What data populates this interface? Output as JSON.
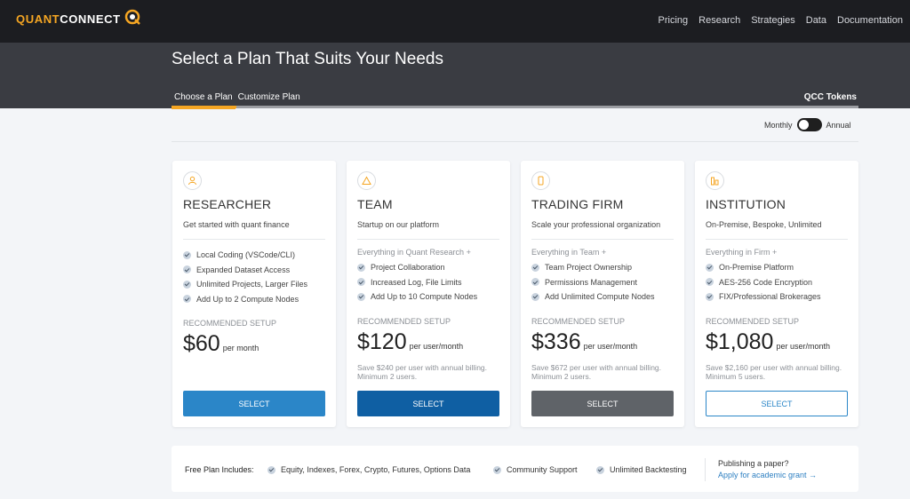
{
  "nav": {
    "logo_q": "QUANT",
    "logo_rest": "CONNECT",
    "links": [
      "Pricing",
      "Research",
      "Strategies",
      "Data",
      "Documentation"
    ]
  },
  "header": {
    "title": "Select a Plan That Suits Your Needs",
    "tabs": [
      "Choose a Plan",
      "Customize Plan"
    ],
    "right_tab": "QCC Tokens"
  },
  "billing": {
    "left": "Monthly",
    "right": "Annual"
  },
  "plans": [
    {
      "name": "RESEARCHER",
      "desc": "Get started with quant finance",
      "lead": "",
      "features": [
        "Local Coding (VSCode/CLI)",
        "Expanded Dataset Access",
        "Unlimited Projects, Larger Files",
        "Add Up to 2 Compute Nodes"
      ],
      "rec": "RECOMMENDED SETUP",
      "price": "$60",
      "per": "per month",
      "note": "",
      "button": "SELECT",
      "icon": "user-icon"
    },
    {
      "name": "TEAM",
      "desc": "Startup on our platform",
      "lead": "Everything in Quant Research +",
      "features": [
        "Project Collaboration",
        "Increased Log, File Limits",
        "Add Up to 10 Compute Nodes"
      ],
      "rec": "RECOMMENDED SETUP",
      "price": "$120",
      "per": "per user/month",
      "note": "Save $240 per user with annual billing. Minimum 2 users.",
      "button": "SELECT",
      "icon": "triangle-icon"
    },
    {
      "name": "TRADING FIRM",
      "desc": "Scale your professional organization",
      "lead": "Everything in Team +",
      "features": [
        "Team Project Ownership",
        "Permissions Management",
        "Add Unlimited Compute Nodes"
      ],
      "rec": "RECOMMENDED SETUP",
      "price": "$336",
      "per": "per user/month",
      "note": "Save $672 per user with annual billing. Minimum 2 users.",
      "button": "SELECT",
      "icon": "phone-icon"
    },
    {
      "name": "INSTITUTION",
      "desc": "On-Premise, Bespoke, Unlimited",
      "lead": "Everything in Firm +",
      "features": [
        "On-Premise Platform",
        "AES-256 Code Encryption",
        "FIX/Professional Brokerages"
      ],
      "rec": "RECOMMENDED SETUP",
      "price": "$1,080",
      "per": "per user/month",
      "note": "Save $2,160 per user with annual billing. Minimum 5 users.",
      "button": "SELECT",
      "icon": "building-icon"
    }
  ],
  "free": {
    "label": "Free Plan Includes:",
    "items": [
      "Equity, Indexes, Forex, Crypto, Futures, Options Data",
      "Community Support",
      "Unlimited Backtesting"
    ],
    "publish": "Publishing a paper?",
    "grant": "Apply for academic grant →"
  },
  "colors": {
    "accent": "#f5a623",
    "researcher_btn": "#2b86c8",
    "team_btn": "#0f5fa3",
    "firm_btn": "#5f6368",
    "institution_border": "#2b86c8"
  }
}
